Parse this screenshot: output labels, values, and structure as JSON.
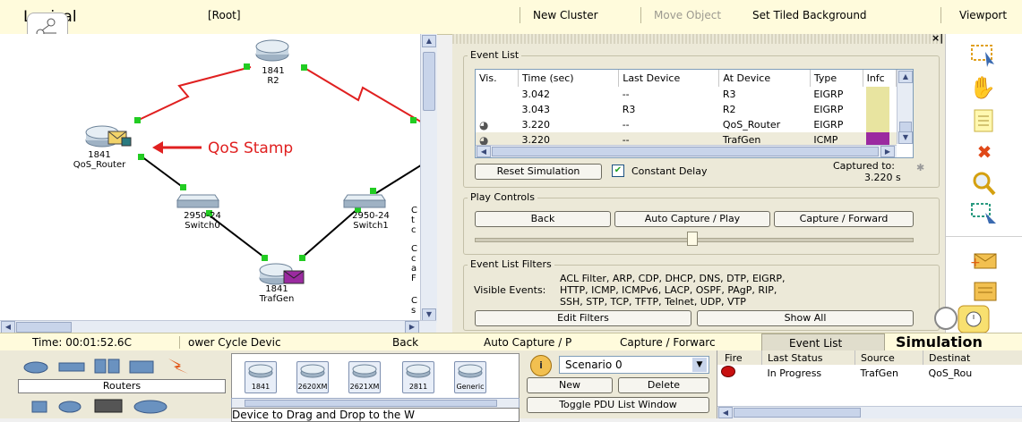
{
  "top_bar": {
    "mode": "Logical",
    "root": "[Root]",
    "new_cluster": "New Cluster",
    "move_object": "Move Object",
    "set_tiled_background": "Set Tiled Background",
    "viewport": "Viewport"
  },
  "topology": {
    "devices": [
      {
        "model": "1841",
        "name": "R2"
      },
      {
        "model": "1841",
        "name": "QoS_Router"
      },
      {
        "model": "2950-24",
        "name": "Switch0"
      },
      {
        "model": "2950-24",
        "name": "Switch1"
      },
      {
        "model": "1841",
        "name": "TrafGen"
      }
    ],
    "annotation": "QoS Stamp",
    "right_edge_letters": [
      "C",
      "t",
      "c",
      "C",
      "c",
      "a",
      "F",
      "C",
      "s"
    ]
  },
  "event_list": {
    "title": "Event List",
    "columns": [
      "Vis.",
      "Time (sec)",
      "Last Device",
      "At Device",
      "Type",
      "Info"
    ],
    "columns_display": [
      "Vis.",
      "Time (sec)",
      "Last Device",
      "At Device",
      "Type",
      "Infc"
    ],
    "rows": [
      {
        "eye": false,
        "time": "3.042",
        "last": "--",
        "at": "R3",
        "type": "EIGRP",
        "info_color": "#e8e4a0"
      },
      {
        "eye": false,
        "time": "3.043",
        "last": "R3",
        "at": "R2",
        "type": "EIGRP",
        "info_color": "#e8e4a0"
      },
      {
        "eye": true,
        "time": "3.220",
        "last": "--",
        "at": "QoS_Router",
        "type": "EIGRP",
        "info_color": "#e8e4a0"
      },
      {
        "eye": true,
        "time": "3.220",
        "last": "--",
        "at": "TrafGen",
        "type": "ICMP",
        "info_color": "#9b2aa0"
      }
    ],
    "reset_simulation": "Reset Simulation",
    "constant_delay": "Constant Delay",
    "constant_delay_checked": true,
    "captured_to_label": "Captured to:",
    "captured_to_value": "3.220 s"
  },
  "play_controls": {
    "title": "Play Controls",
    "back": "Back",
    "auto_capture": "Auto Capture / Play",
    "capture_forward": "Capture / Forward"
  },
  "filters": {
    "title": "Event List Filters",
    "visible_events_label": "Visible Events:",
    "line1": "ACL Filter, ARP, CDP, DHCP, DNS, DTP, EIGRP,",
    "line2": "HTTP, ICMP, ICMPv6, LACP, OSPF, PAgP, RIP,",
    "line3": "SSH, STP, TCP, TFTP, Telnet, UDP, VTP",
    "edit_filters": "Edit Filters",
    "show_all": "Show All"
  },
  "mode_bar": {
    "time": "Time: 00:01:52.6C",
    "power_cycle": "ower Cycle Devic",
    "back": "Back",
    "auto_capture": "Auto Capture / P",
    "capture_forward": "Capture / Forwarc",
    "event_list": "Event List",
    "simulation": "Simulation"
  },
  "device_palette": {
    "category": "Routers",
    "models": [
      "1841",
      "2620XM",
      "2621XM",
      "2811",
      "Generic"
    ],
    "hint": "Device to Drag and Drop to the W"
  },
  "scenario": {
    "selected": "Scenario 0",
    "new": "New",
    "delete": "Delete",
    "toggle": "Toggle PDU List Window"
  },
  "pdu_list": {
    "columns": [
      "Fire",
      "Last Status",
      "Source",
      "Destinat"
    ],
    "rows": [
      {
        "status": "In Progress",
        "source": "TrafGen",
        "dest": "QoS_Rou"
      }
    ]
  },
  "colors": {
    "link_red": "#e02020",
    "link_black": "#000000",
    "port_green": "#22cc22",
    "pdu_purple": "#9b2aa0",
    "pdu_yellow": "#f2d36a"
  }
}
